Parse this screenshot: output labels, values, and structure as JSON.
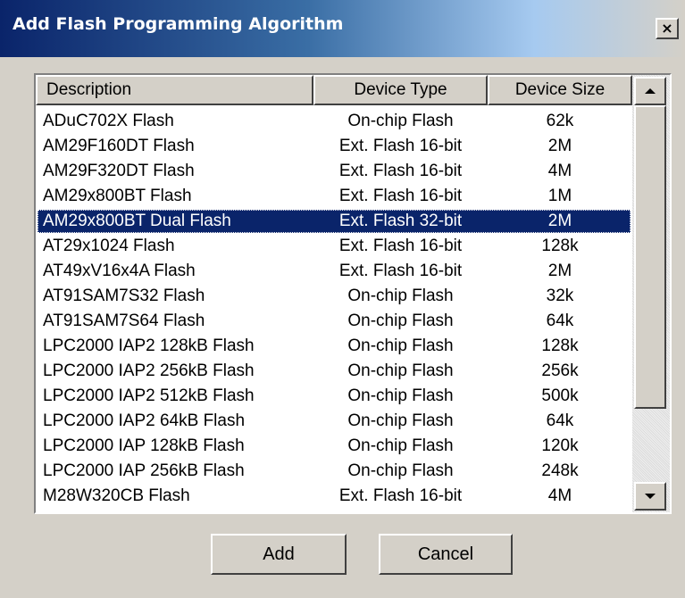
{
  "window": {
    "title": "Add Flash Programming Algorithm",
    "close_glyph": "×"
  },
  "list": {
    "columns": {
      "description": "Description",
      "device_type": "Device Type",
      "device_size": "Device Size"
    },
    "rows": [
      {
        "description": "ADuC702X Flash",
        "device_type": "On-chip Flash",
        "device_size": "62k"
      },
      {
        "description": "AM29F160DT Flash",
        "device_type": "Ext. Flash 16-bit",
        "device_size": "2M"
      },
      {
        "description": "AM29F320DT Flash",
        "device_type": "Ext. Flash 16-bit",
        "device_size": "4M"
      },
      {
        "description": "AM29x800BT Flash",
        "device_type": "Ext. Flash 16-bit",
        "device_size": "1M"
      },
      {
        "description": "AM29x800BT Dual Flash",
        "device_type": "Ext. Flash 32-bit",
        "device_size": "2M"
      },
      {
        "description": "AT29x1024 Flash",
        "device_type": "Ext. Flash 16-bit",
        "device_size": "128k"
      },
      {
        "description": "AT49xV16x4A Flash",
        "device_type": "Ext. Flash 16-bit",
        "device_size": "2M"
      },
      {
        "description": "AT91SAM7S32 Flash",
        "device_type": "On-chip Flash",
        "device_size": "32k"
      },
      {
        "description": "AT91SAM7S64 Flash",
        "device_type": "On-chip Flash",
        "device_size": "64k"
      },
      {
        "description": "LPC2000 IAP2 128kB Flash",
        "device_type": "On-chip Flash",
        "device_size": "128k"
      },
      {
        "description": "LPC2000 IAP2 256kB Flash",
        "device_type": "On-chip Flash",
        "device_size": "256k"
      },
      {
        "description": "LPC2000 IAP2 512kB Flash",
        "device_type": "On-chip Flash",
        "device_size": "500k"
      },
      {
        "description": "LPC2000 IAP2 64kB Flash",
        "device_type": "On-chip Flash",
        "device_size": "64k"
      },
      {
        "description": "LPC2000 IAP 128kB Flash",
        "device_type": "On-chip Flash",
        "device_size": "120k"
      },
      {
        "description": "LPC2000 IAP 256kB Flash",
        "device_type": "On-chip Flash",
        "device_size": "248k"
      },
      {
        "description": "M28W320CB Flash",
        "device_type": "Ext. Flash 16-bit",
        "device_size": "4M"
      }
    ],
    "selected_index": 4
  },
  "buttons": {
    "add_label": "Add",
    "cancel_label": "Cancel"
  },
  "icons": {
    "scroll_up": "scroll-up-arrow-icon",
    "scroll_down": "scroll-down-arrow-icon",
    "close": "close-icon"
  },
  "colors": {
    "title_gradient_start": "#0a246a",
    "selection": "#0a246a",
    "dialog_face": "#d4d0c8"
  }
}
